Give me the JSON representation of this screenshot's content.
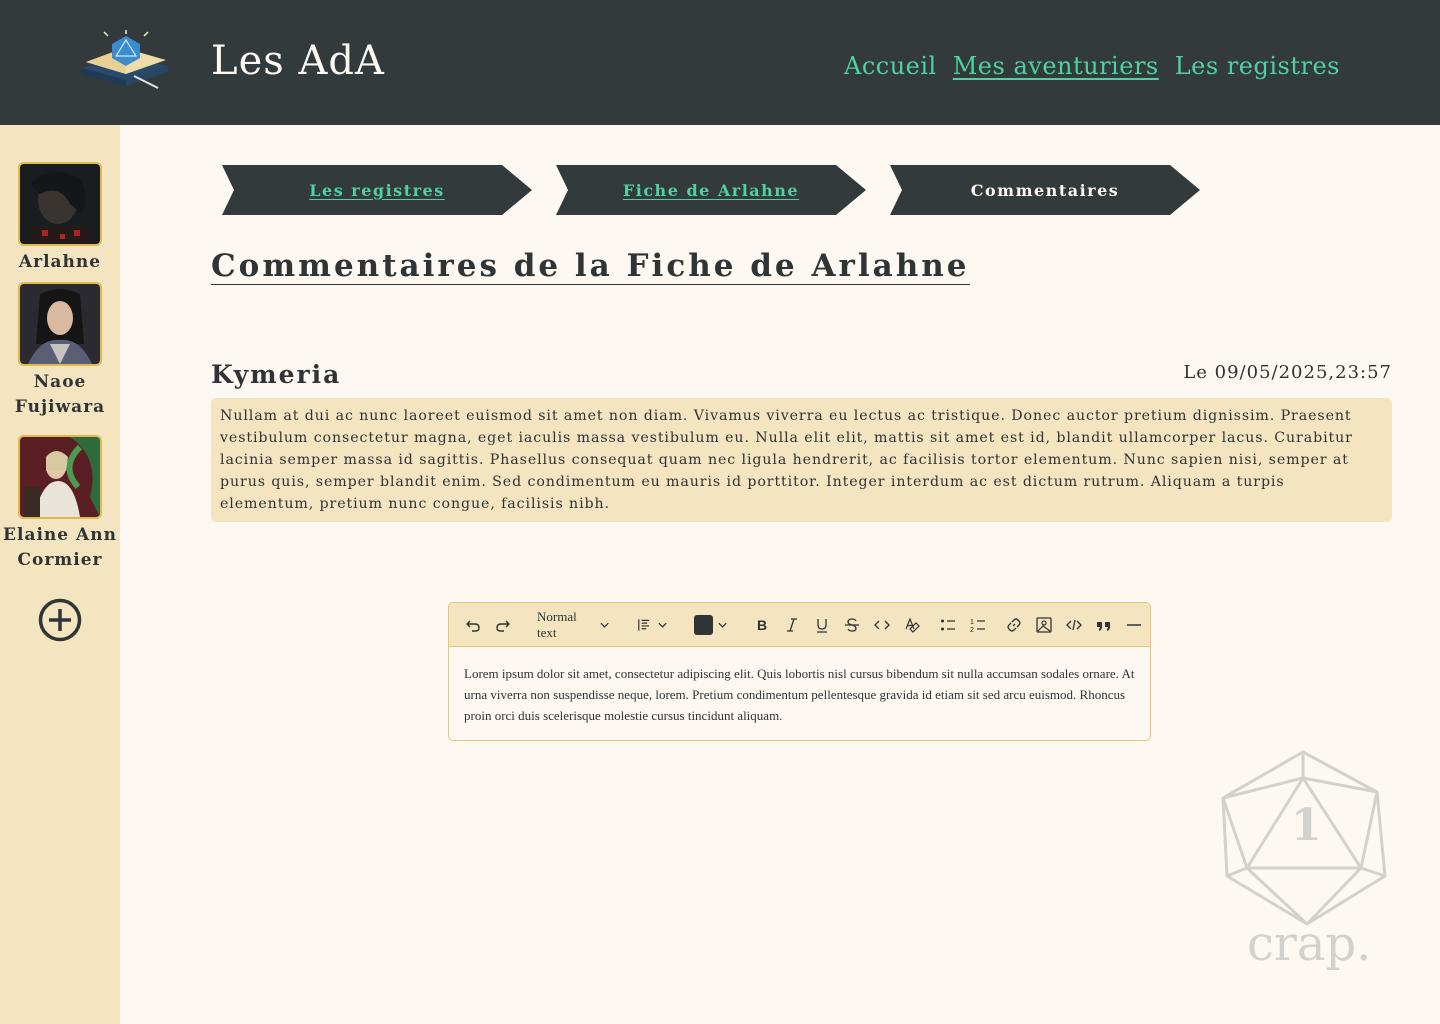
{
  "header": {
    "site_title": "Les AdA",
    "nav": [
      {
        "label": "Accueil",
        "active": false
      },
      {
        "label": "Mes aventuriers",
        "active": true
      },
      {
        "label": "Les registres",
        "active": false
      }
    ]
  },
  "sidebar": {
    "characters": [
      {
        "name": "Arlahne"
      },
      {
        "name": "Naoe Fujiwara"
      },
      {
        "name": "Elaine Ann Cormier"
      }
    ]
  },
  "breadcrumb": [
    {
      "label": "Les registres",
      "link": true
    },
    {
      "label": "Fiche de Arlahne",
      "link": true
    },
    {
      "label": "Commentaires",
      "link": false
    }
  ],
  "page": {
    "title": "Commentaires de la Fiche de Arlahne"
  },
  "comment": {
    "author": "Kymeria",
    "date": "Le 09/05/2025,23:57",
    "text": "Nullam at dui ac nunc laoreet euismod sit amet non diam. Vivamus viverra eu lectus ac tristique. Donec auctor pretium dignissim. Praesent vestibulum consectetur magna, eget iaculis massa vestibulum eu. Nulla  elit elit, mattis sit amet est id, blandit ullamcorper lacus. Curabitur  lacinia semper massa id sagittis. Phasellus consequat quam nec ligula  hendrerit, ac facilisis tortor elementum. Nunc sapien nisi, semper at  purus quis, semper blandit enim. Sed condimentum eu mauris id porttitor. Integer interdum ac est dictum rutrum. Aliquam a turpis elementum,  pretium nunc congue, facilisis nibh."
  },
  "editor": {
    "block_type": "Normal text",
    "text_color": "#2f3436",
    "content": "Lorem ipsum dolor sit amet, consectetur adipiscing elit. Quis lobortis nisl cursus bibendum sit nulla accumsan sodales ornare. At urna viverra non suspendisse neque, lorem. Pretium condimentum pellentesque gravida id etiam sit sed arcu euismod. Rhoncus proin orci duis scelerisque molestie cursus tincidunt aliquam."
  },
  "watermark": {
    "text": "crap.",
    "die_number": "1"
  },
  "colors": {
    "header_bg": "#333a3b",
    "accent": "#4fd1a0",
    "sidebar_bg": "#f4e4c0",
    "page_bg": "#fdf8f2",
    "avatar_border": "#e0b84e"
  }
}
